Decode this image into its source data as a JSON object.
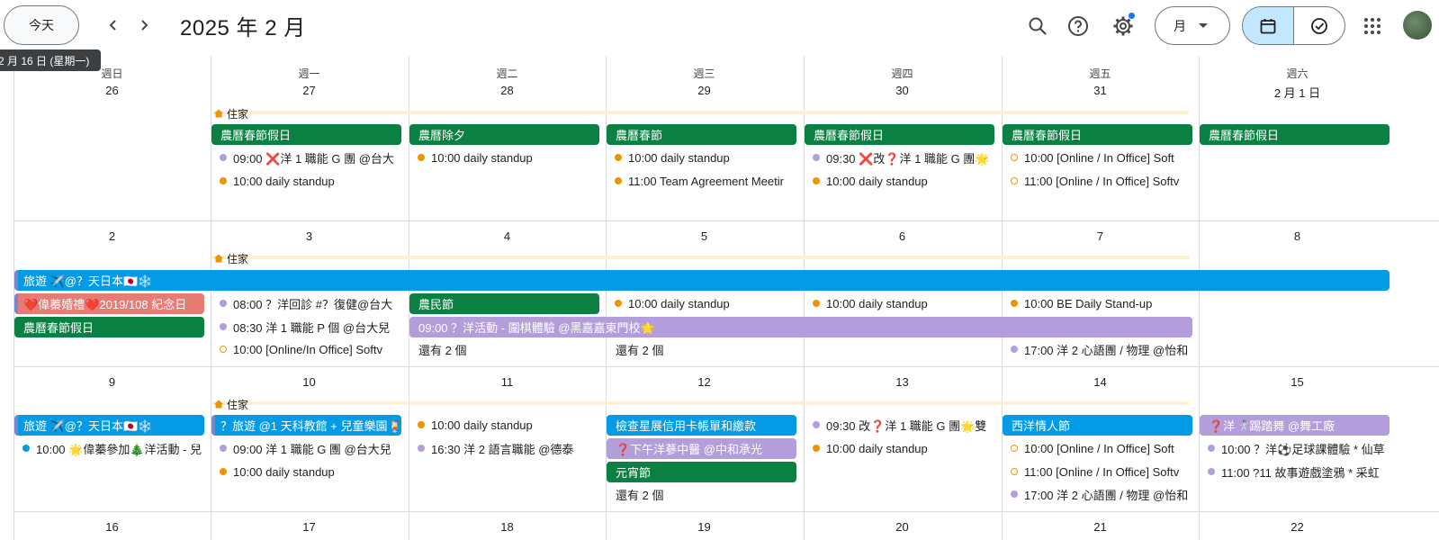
{
  "toolbar": {
    "today_label": "今天",
    "title": "2025 年 2 月",
    "view_label": "月",
    "tooltip": "2 月 16 日 (星期一)"
  },
  "icons": {
    "prev": "chevron-left-icon",
    "next": "chevron-right-icon",
    "search": "search-icon",
    "help": "help-icon",
    "settings": "gear-icon",
    "calendar_view": "calendar-icon",
    "tasks_view": "check-circle-icon",
    "apps": "apps-grid-icon",
    "home": "home-icon"
  },
  "colors": {
    "green": "#0b8043",
    "blue": "#039be5",
    "purple": "#b39ddb",
    "salmon": "#e67c73",
    "orange": "#f09300",
    "selected_view": "#c2e7ff"
  },
  "weekdays": [
    "週日",
    "週一",
    "週二",
    "週三",
    "週四",
    "週五",
    "週六"
  ],
  "weeks": [
    {
      "days": [
        "26",
        "27",
        "28",
        "29",
        "30",
        "31",
        "2 月 1 日"
      ]
    },
    {
      "days": [
        "2",
        "3",
        "4",
        "5",
        "6",
        "7",
        "8"
      ]
    },
    {
      "days": [
        "9",
        "10",
        "11",
        "12",
        "13",
        "14",
        "15"
      ]
    },
    {
      "days": [
        "16",
        "17",
        "18",
        "19",
        "20",
        "21",
        "22"
      ]
    }
  ],
  "home_label": "住家",
  "events": {
    "w1_chips": [
      "農曆春節假日",
      "農曆除夕",
      "農曆春節",
      "農曆春節假日",
      "農曆春節假日",
      "農曆春節假日"
    ],
    "w1_mon_1": "09:00 ❌洋 1 職能 G 團 @台大",
    "w1_mon_2": "10:00 daily standup",
    "w1_tue_1": "10:00 daily standup",
    "w1_wed_1": "10:00 daily standup",
    "w1_wed_2": "11:00 Team Agreement Meetir",
    "w1_thu_1": "09:30 ❌改❓洋 1 職能 G 團🌟",
    "w1_thu_2": "10:00 daily standup",
    "w1_fri_1": "10:00 [Online / In Office] Soft",
    "w1_fri_2": "11:00 [Online / In Office] Softv",
    "w2_travel": "旅遊 ✈️@？天日本🇯🇵❄️",
    "w2_sun_chip1": "❤️偉蓁婚禮❤️2019/108 紀念日",
    "w2_sun_chip2": "農曆春節假日",
    "w2_mon_1": "08:00 ？洋回診 #？復健@台大",
    "w2_mon_2": "08:30 洋 1 職能 P 個 @台大兒",
    "w2_mon_3": "10:00 [Online/In Office] Softv",
    "w2_tue_chip": "農民節",
    "w2_multi": "09:00 ？洋活動 - 圍棋體驗 @黑嘉嘉東門校🌟",
    "w2_tue_more": "還有 2 個",
    "w2_wed_1": "10:00 daily standup",
    "w2_wed_more": "還有 2 個",
    "w2_thu_1": "10:00 daily standup",
    "w2_fri_1": "10:00 BE Daily Stand-up",
    "w2_fri_2": "17:00 洋 2 心語團 / 物理 @怡和",
    "w3_travel": "旅遊 ✈️@？天日本🇯🇵❄️",
    "w3_sun_1": "10:00 🌟偉蓁參加🎄洋活動 - 兒",
    "w3_mon_chip": "？旅遊 @1 天科教館 + 兒童樂園🍹",
    "w3_mon_1": "09:00 洋 1 職能 G 團 @台大兒",
    "w3_mon_2": "10:00 daily standup",
    "w3_tue_1": "10:00 daily standup",
    "w3_tue_2": "16:30 洋 2 語言職能 @德泰",
    "w3_wed_chip1": "檢查星展信用卡帳單和繳款",
    "w3_wed_chip2": "❓下午洋蔘中醫 @中和承光",
    "w3_wed_chip3": "元宵節",
    "w3_wed_more": "還有 2 個",
    "w3_thu_1": "09:30 改❓洋 1 職能 G 團🌟雙",
    "w3_thu_2": "10:00 daily standup",
    "w3_fri_chip": "西洋情人節",
    "w3_fri_1": "10:00 [Online / In Office] Soft",
    "w3_fri_2": "11:00 [Online / In Office] Softv",
    "w3_fri_3": "17:00 洋 2 心語團 / 物理 @怡和",
    "w3_sat_chip": "❓洋🤺踢踏舞 @舞工廠",
    "w3_sat_1": "10:00 ？洋⚽足球課體驗 * 仙草",
    "w3_sat_2": "11:00 ?11 故事遊戲塗鴉 * 采虹"
  }
}
